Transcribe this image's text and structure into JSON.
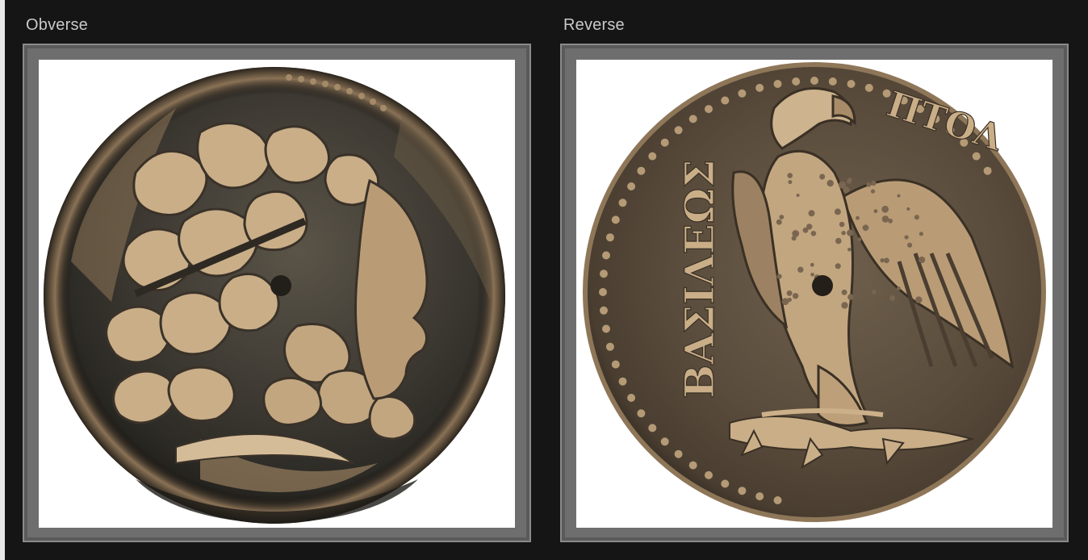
{
  "panels": {
    "obverse": {
      "label": "Obverse",
      "image": "coin-obverse-zeus-head"
    },
    "reverse": {
      "label": "Reverse",
      "image": "coin-reverse-eagle",
      "legend": "ΒΑΣΙΛΕΩΣ ΠΤΟΛ"
    }
  },
  "colors": {
    "background": "#151515",
    "label": "#c9c9c9",
    "frame": "#6e6e6e",
    "well": "#ffffff",
    "coin_dark": "#2f2b24",
    "coin_bronze": "#b89a74",
    "coin_highlight": "#d8c0a0",
    "patina": "#3c4a40"
  }
}
